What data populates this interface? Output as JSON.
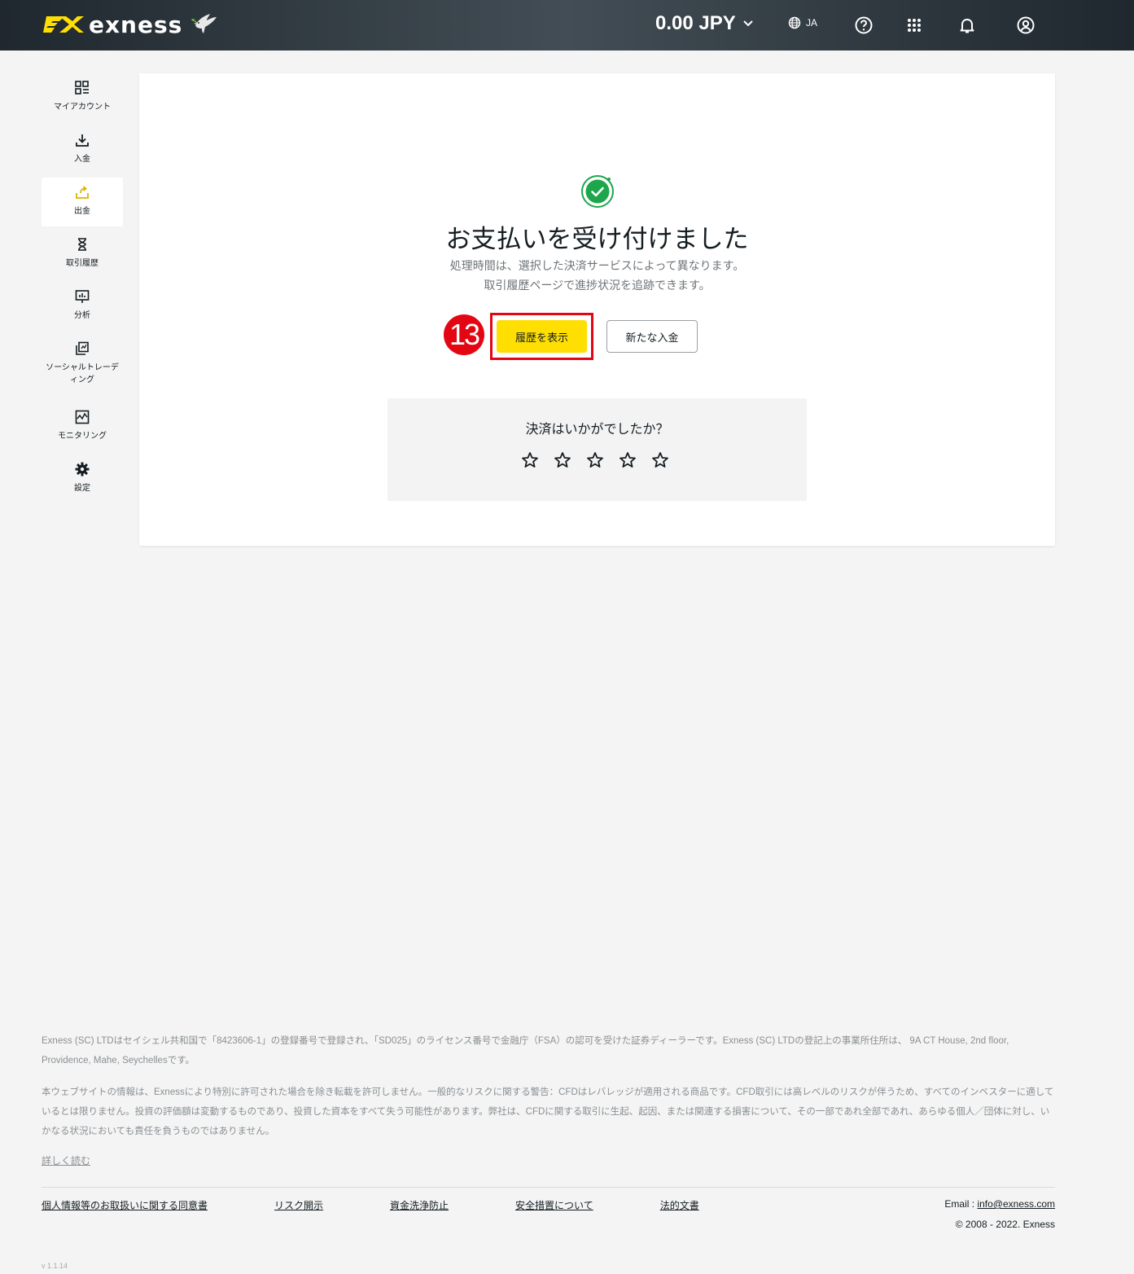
{
  "header": {
    "brand": "exness",
    "balance": "0.00 JPY",
    "language": "JA",
    "icons": [
      "globe-icon",
      "help-icon",
      "apps-grid-icon",
      "bell-icon",
      "user-icon"
    ]
  },
  "sidebar": {
    "items": [
      {
        "label": "マイアカウント",
        "icon": "dashboard-icon"
      },
      {
        "label": "入金",
        "icon": "download-icon"
      },
      {
        "label": "出金",
        "icon": "upload-icon",
        "active": true
      },
      {
        "label": "取引履歴",
        "icon": "hourglass-icon"
      },
      {
        "label": "分析",
        "icon": "chart-board-icon"
      },
      {
        "label": "ソーシャルトレーディング",
        "icon": "copy-icon"
      },
      {
        "label": "モニタリング",
        "icon": "monitor-chart-icon"
      },
      {
        "label": "設定",
        "icon": "gear-icon"
      }
    ]
  },
  "main": {
    "title": "お支払いを受け付けました",
    "subtitle_line1": "処理時間は、選択した決済サービスによって異なります。",
    "subtitle_line2": "取引履歴ページで進捗状況を追跡できます。",
    "annotation": "13",
    "primary_button": "履歴を表示",
    "secondary_button": "新たな入金",
    "feedback_question": "決済はいかがでしたか？",
    "rating_max": 5
  },
  "footer": {
    "legal1": "Exness (SC) LTDはセイシェル共和国で「8423606-1」の登録番号で登録され、「SD025」のライセンス番号で金融庁（FSA）の認可を受けた証券ディーラーです。Exness (SC) LTDの登記上の事業所住所は、 9A CT House, 2nd floor, Providence, Mahe, Seychellesです。",
    "legal2": "本ウェブサイトの情報は、Exnessにより特別に許可された場合を除き転載を許可しません。一般的なリスクに関する警告：CFDはレバレッジが適用される商品です。CFD取引には高レベルのリスクが伴うため、すべてのインベスターに適しているとは限りません。投資の評価額は変動するものであり、投資した資本をすべて失う可能性があります。弊社は、CFDに関する取引に生起、起因、または関連する損害について、その一部であれ全部であれ、あらゆる個人／団体に対し、いかなる状況においても責任を負うものではありません。",
    "read_more": "詳しく読む",
    "links": [
      "個人情報等のお取扱いに関する同意書",
      "リスク開示",
      "資金洗浄防止",
      "安全措置について",
      "法的文書"
    ],
    "email_label": "Email : ",
    "email": "info@exness.com",
    "copyright": "© 2008 - 2022. Exness",
    "version": "v 1.1.14"
  },
  "colors": {
    "accent": "#ffde02",
    "success": "#1ea64c",
    "annotation": "#e30613"
  }
}
